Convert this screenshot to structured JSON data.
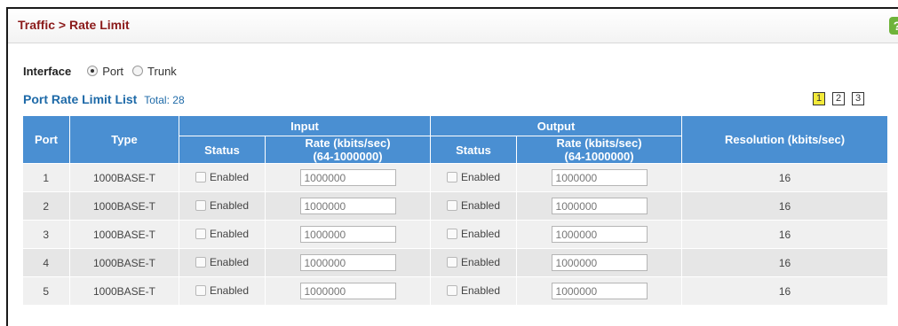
{
  "header": {
    "breadcrumb": "Traffic > Rate Limit",
    "help_glyph": "?"
  },
  "interface": {
    "label": "Interface",
    "options": [
      {
        "label": "Port",
        "checked": true
      },
      {
        "label": "Trunk",
        "checked": false
      }
    ]
  },
  "list": {
    "title": "Port Rate Limit List",
    "total_label": "Total: 28",
    "pages": [
      "1",
      "2",
      "3"
    ],
    "current_page": "1"
  },
  "table": {
    "headers": {
      "port": "Port",
      "type": "Type",
      "input": "Input",
      "output": "Output",
      "status": "Status",
      "rate_line1": "Rate (kbits/sec)",
      "rate_line2": "(64-1000000)",
      "resolution": "Resolution (kbits/sec)"
    },
    "rows": [
      {
        "port": "1",
        "type": "1000BASE-T",
        "in_status": "Enabled",
        "in_rate": "1000000",
        "out_status": "Enabled",
        "out_rate": "1000000",
        "resolution": "16"
      },
      {
        "port": "2",
        "type": "1000BASE-T",
        "in_status": "Enabled",
        "in_rate": "1000000",
        "out_status": "Enabled",
        "out_rate": "1000000",
        "resolution": "16"
      },
      {
        "port": "3",
        "type": "1000BASE-T",
        "in_status": "Enabled",
        "in_rate": "1000000",
        "out_status": "Enabled",
        "out_rate": "1000000",
        "resolution": "16"
      },
      {
        "port": "4",
        "type": "1000BASE-T",
        "in_status": "Enabled",
        "in_rate": "1000000",
        "out_status": "Enabled",
        "out_rate": "1000000",
        "resolution": "16"
      },
      {
        "port": "5",
        "type": "1000BASE-T",
        "in_status": "Enabled",
        "in_rate": "1000000",
        "out_status": "Enabled",
        "out_rate": "1000000",
        "resolution": "16"
      }
    ]
  },
  "colors": {
    "title": "#8b1a1a",
    "list_title": "#1e6aa8",
    "header_bg": "#4a8fd2",
    "active_page": "#f3ea3a",
    "help": "#6fb33a"
  }
}
